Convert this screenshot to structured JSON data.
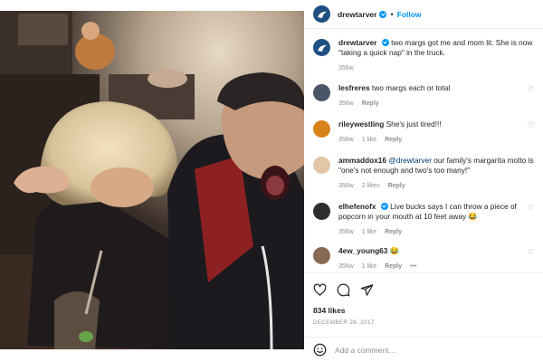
{
  "post": {
    "author": "drewtarver",
    "follow_label": "Follow",
    "separator": "•",
    "caption": {
      "user": "drewtarver",
      "text": "two margs got me and mom lit. She is now \"taking a quick nap\" in the truck.",
      "age": "356w"
    },
    "comments": [
      {
        "user": "lesfreres",
        "text": "two margs each or total",
        "age": "356w",
        "likes": "",
        "reply": "Reply",
        "verified": false,
        "avatar": "#4a5568"
      },
      {
        "user": "rileywestling",
        "text": "She's just tired!!!",
        "age": "356w",
        "likes": "1 like",
        "reply": "Reply",
        "verified": false,
        "avatar": "#d9821c"
      },
      {
        "user": "ammaddox16",
        "mention": "@drewtarver",
        "text": "our family's margarita motto is \"one's not enough and two's too many!\"",
        "age": "356w",
        "likes": "2 likes",
        "reply": "Reply",
        "verified": false,
        "avatar": "#e3c6a8"
      },
      {
        "user": "elhefenofx",
        "text": "Live bucks says I can throw a piece of popcorn in your mouth at 10 feet away 😂",
        "age": "356w",
        "likes": "1 like",
        "reply": "Reply",
        "verified": true,
        "avatar": "#2d2d2d"
      },
      {
        "user": "4ew_young63",
        "text": "😂",
        "age": "356w",
        "likes": "1 like",
        "reply": "Reply",
        "more": "•••",
        "verified": false,
        "avatar": "#8a6a55"
      }
    ],
    "likes": "834 likes",
    "date": "DECEMBER 28, 2017",
    "add_comment_placeholder": "Add a comment…"
  },
  "icons": {
    "like": "heart-icon",
    "comment": "comment-bubble-icon",
    "share": "paper-plane-icon",
    "emoji": "smiley-icon",
    "comment_like": "small-heart-icon",
    "verified": "verified-badge-icon"
  },
  "colors": {
    "link": "#0095f6",
    "mention": "#00376b",
    "muted": "#8e8e8e",
    "text": "#262626",
    "divider": "#efefef"
  }
}
